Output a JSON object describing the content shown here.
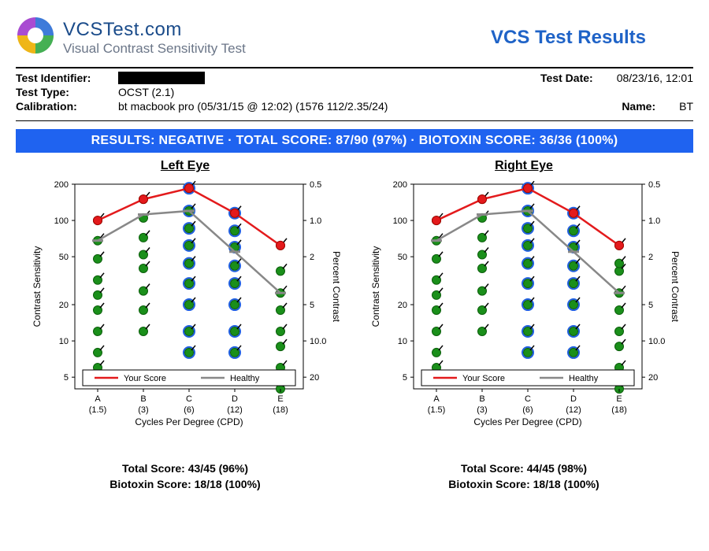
{
  "brand": {
    "name": "VCSTest.com",
    "subtitle": "Visual Contrast Sensitivity Test"
  },
  "page_title": "VCS Test Results",
  "metadata": {
    "test_identifier_label": "Test Identifier:",
    "test_identifier_value": "",
    "test_type_label": "Test Type:",
    "test_type_value": "OCST (2.1)",
    "test_date_label": "Test Date:",
    "test_date_value": "08/23/16, 12:01",
    "calibration_label": "Calibration:",
    "calibration_value": "bt macbook pro (05/31/15 @ 12:02) (1576 112/2.35/24)",
    "name_label": "Name:",
    "name_value": "BT"
  },
  "results_bar": "RESULTS:  NEGATIVE   ·   TOTAL SCORE:  87/90 (97%)   ·   BIOTOXIN SCORE:  36/36 (100%)",
  "axis": {
    "y_left_label": "Contrast Sensitivity",
    "y_right_label": "Percent Contrast",
    "x_label": "Cycles Per Degree (CPD)",
    "y_left_ticks": [
      "5",
      "10",
      "20",
      "50",
      "100",
      "200"
    ],
    "y_right_ticks": [
      "20",
      "10.0",
      "5",
      "2",
      "1.0",
      "0.5"
    ],
    "x_letters": [
      "A",
      "B",
      "C",
      "D",
      "E"
    ],
    "x_cpd": [
      "(1.5)",
      "(3)",
      "(6)",
      "(12)",
      "(18)"
    ]
  },
  "legend": {
    "your_score": "Your Score",
    "healthy": "Healthy"
  },
  "left_eye": {
    "title": "Left Eye",
    "total": "Total Score: 43/45 (96%)",
    "biotoxin": "Biotoxin Score: 18/18 (100%)"
  },
  "right_eye": {
    "title": "Right Eye",
    "total": "Total Score: 44/45 (98%)",
    "biotoxin": "Biotoxin Score: 18/18 (100%)"
  },
  "chart_data": [
    {
      "type": "line",
      "title": "Left Eye",
      "xlabel": "Cycles Per Degree (CPD)",
      "ylabel": "Contrast Sensitivity",
      "y2label": "Percent Contrast",
      "scale": "log",
      "ylim": [
        4,
        200
      ],
      "categories": [
        "A (1.5)",
        "B (3)",
        "C (6)",
        "D (12)",
        "E (18)"
      ],
      "series": [
        {
          "name": "Your Score",
          "color": "#e31a1c",
          "values": [
            100,
            150,
            185,
            115,
            62
          ]
        },
        {
          "name": "Healthy",
          "color": "#888888",
          "values": [
            68,
            112,
            120,
            55,
            25
          ]
        }
      ],
      "column_values": {
        "A": [
          6,
          8,
          12,
          18,
          24,
          32,
          48,
          68,
          100
        ],
        "B": [
          12,
          18,
          26,
          40,
          52,
          72,
          105,
          150
        ],
        "C": [
          8,
          12,
          20,
          30,
          44,
          62,
          86,
          120,
          185
        ],
        "D": [
          8,
          12,
          20,
          30,
          42,
          60,
          82,
          115
        ],
        "E": [
          4,
          6,
          9,
          12,
          18,
          25,
          38,
          62
        ]
      },
      "biotoxin_highlight_columns": [
        "C",
        "D"
      ]
    },
    {
      "type": "line",
      "title": "Right Eye",
      "xlabel": "Cycles Per Degree (CPD)",
      "ylabel": "Contrast Sensitivity",
      "y2label": "Percent Contrast",
      "scale": "log",
      "ylim": [
        4,
        200
      ],
      "categories": [
        "A (1.5)",
        "B (3)",
        "C (6)",
        "D (12)",
        "E (18)"
      ],
      "series": [
        {
          "name": "Your Score",
          "color": "#e31a1c",
          "values": [
            100,
            150,
            185,
            115,
            62
          ]
        },
        {
          "name": "Healthy",
          "color": "#888888",
          "values": [
            68,
            112,
            120,
            55,
            25
          ]
        }
      ],
      "column_values": {
        "A": [
          6,
          8,
          12,
          18,
          24,
          32,
          48,
          68,
          100
        ],
        "B": [
          12,
          18,
          26,
          40,
          52,
          72,
          105,
          150
        ],
        "C": [
          8,
          12,
          20,
          30,
          44,
          62,
          86,
          120,
          185
        ],
        "D": [
          8,
          12,
          20,
          30,
          42,
          60,
          82,
          115
        ],
        "E": [
          4,
          6,
          9,
          12,
          18,
          25,
          38,
          44,
          62
        ]
      },
      "biotoxin_highlight_columns": [
        "C",
        "D"
      ]
    }
  ]
}
